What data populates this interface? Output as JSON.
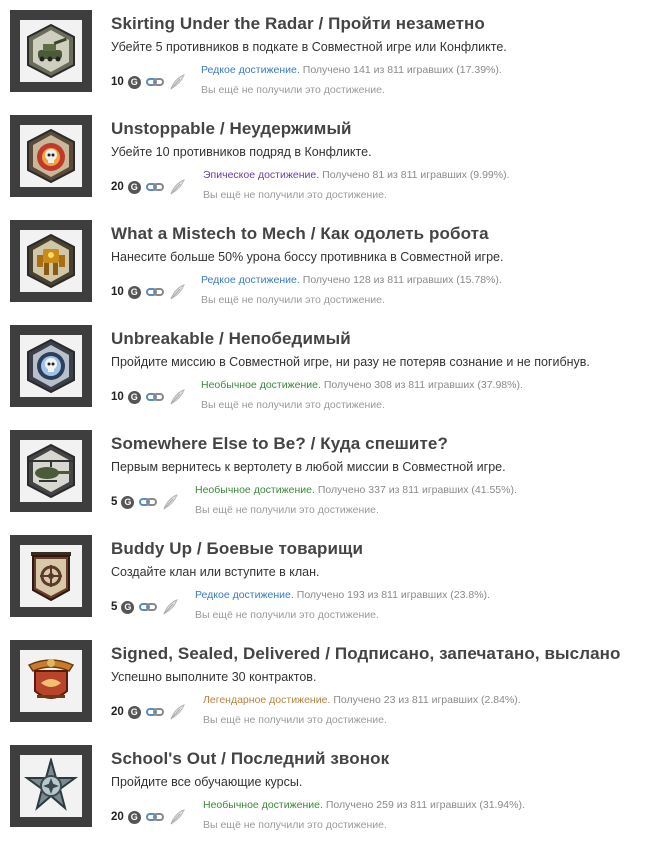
{
  "colors": {
    "rare": "#3a7bbf",
    "epic": "#6a3fa0",
    "uncommon": "#3a8a3a",
    "legendary": "#b8833a",
    "frame": "#3e3e3e"
  },
  "achievements": [
    {
      "title": "Skirting Under the Radar / Пройти незаметно",
      "description": "Убейте 5 противников в подкате в Совместной игре или Конфликте.",
      "points": "10",
      "rarity": "Редкое достижение.",
      "rarity_kind": "rare",
      "stats": "Получено 141 из 811 игравших (17.39%).",
      "status": "Вы ещё не получили это достижение.",
      "icon": "tank-icon"
    },
    {
      "title": "Unstoppable / Неудержимый",
      "description": "Убейте 10 противников подряд в Конфликте.",
      "points": "20",
      "rarity": "Эпическое достижение.",
      "rarity_kind": "epic",
      "stats": "Получено 81 из 811 игравших (9.99%).",
      "status": "Вы ещё не получили это достижение.",
      "icon": "skull-explosion-icon"
    },
    {
      "title": "What a Mistech to Mech / Как одолеть робота",
      "description": "Нанесите больше 50% урона боссу противника в Совместной игре.",
      "points": "10",
      "rarity": "Редкое достижение.",
      "rarity_kind": "rare",
      "stats": "Получено 128 из 811 игравших (15.78%).",
      "status": "Вы ещё не получили это достижение.",
      "icon": "mech-icon"
    },
    {
      "title": "Unbreakable / Непобедимый",
      "description": "Пройдите миссию в Совместной игре, ни разу не потеряв сознание и не погибнув.",
      "points": "10",
      "rarity": "Необычное достижение.",
      "rarity_kind": "uncommon",
      "stats": "Получено 308 из 811 игравших (37.98%).",
      "status": "Вы ещё не получили это достижение.",
      "icon": "shield-skull-icon"
    },
    {
      "title": "Somewhere Else to Be? / Куда спешите?",
      "description": "Первым вернитесь к вертолету в любой миссии в Совместной игре.",
      "points": "5",
      "rarity": "Необычное достижение.",
      "rarity_kind": "uncommon",
      "stats": "Получено 337 из 811 игравших (41.55%).",
      "status": "Вы ещё не получили это достижение.",
      "icon": "helicopter-icon"
    },
    {
      "title": "Buddy Up / Боевые товарищи",
      "description": "Создайте клан или вступите в клан.",
      "points": "5",
      "rarity": "Редкое достижение.",
      "rarity_kind": "rare",
      "stats": "Получено 193 из 811 игравших (23.8%).",
      "status": "Вы ещё не получили это достижение.",
      "icon": "banner-icon"
    },
    {
      "title": "Signed, Sealed, Delivered / Подписано, запечатано, выслано",
      "description": "Успешно выполните 30 контрактов.",
      "points": "20",
      "rarity": "Легендарное достижение.",
      "rarity_kind": "legendary",
      "stats": "Получено 23 из 811 игравших (2.84%).",
      "status": "Вы ещё не получили это достижение.",
      "icon": "eagle-handshake-icon"
    },
    {
      "title": "School's Out / Последний звонок",
      "description": "Пройдите все обучающие курсы.",
      "points": "20",
      "rarity": "Необычное достижение.",
      "rarity_kind": "uncommon",
      "stats": "Получено 259 из 811 игравших (31.94%).",
      "status": "Вы ещё не получили это достижение.",
      "icon": "medal-icon"
    }
  ],
  "g_label": "G"
}
